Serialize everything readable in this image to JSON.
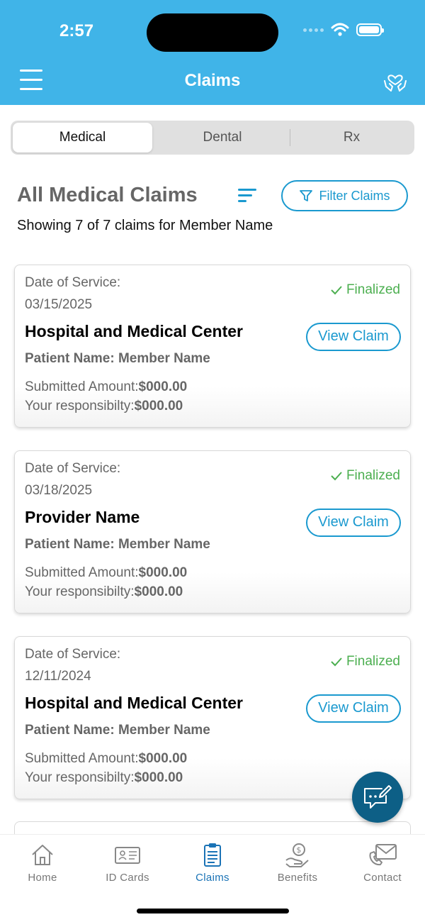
{
  "status_bar": {
    "time": "2:57"
  },
  "header": {
    "title": "Claims"
  },
  "tabs": [
    {
      "label": "Medical",
      "active": true
    },
    {
      "label": "Dental",
      "active": false
    },
    {
      "label": "Rx",
      "active": false
    }
  ],
  "section": {
    "title": "All Medical Claims",
    "filter_label": "Filter Claims",
    "showing": "Showing 7 of 7 claims for Member Name"
  },
  "claims": [
    {
      "dos_label": "Date of Service:",
      "date": "03/15/2025",
      "status": "Finalized",
      "provider": "Hospital and Medical Center",
      "view_label": "View Claim",
      "patient": "Patient Name: Member Name",
      "submitted_label": "Submitted Amount:",
      "submitted_amount": "$000.00",
      "responsibility_label": "Your responsibilty:",
      "responsibility_amount": "$000.00"
    },
    {
      "dos_label": "Date of Service:",
      "date": "03/18/2025",
      "status": "Finalized",
      "provider": "Provider Name",
      "view_label": "View Claim",
      "patient": "Patient Name: Member Name",
      "submitted_label": "Submitted Amount:",
      "submitted_amount": "$000.00",
      "responsibility_label": "Your responsibilty:",
      "responsibility_amount": "$000.00"
    },
    {
      "dos_label": "Date of Service:",
      "date": "12/11/2024",
      "status": "Finalized",
      "provider": "Hospital and Medical Center",
      "view_label": "View Claim",
      "patient": "Patient Name: Member Name",
      "submitted_label": "Submitted Amount:",
      "submitted_amount": "$000.00",
      "responsibility_label": "Your responsibilty:",
      "responsibility_amount": "$000.00"
    }
  ],
  "bottom_nav": [
    {
      "label": "Home",
      "icon": "home-icon",
      "active": false
    },
    {
      "label": "ID Cards",
      "icon": "id-card-icon",
      "active": false
    },
    {
      "label": "Claims",
      "icon": "clipboard-icon",
      "active": true
    },
    {
      "label": "Benefits",
      "icon": "benefits-icon",
      "active": false
    },
    {
      "label": "Contact",
      "icon": "envelope-icon",
      "active": false
    }
  ],
  "colors": {
    "header": "#40b4e8",
    "accent": "#1a99cf",
    "status_green": "#4caf50",
    "nav_active": "#1a73b6",
    "chat_fab": "#0d5f86"
  }
}
